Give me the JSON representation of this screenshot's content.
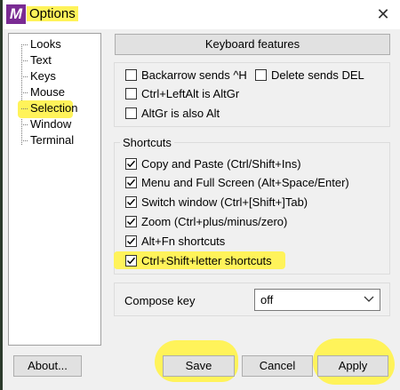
{
  "window": {
    "title": "Options",
    "app_icon": "mintty-logo"
  },
  "tree": {
    "items": [
      "Looks",
      "Text",
      "Keys",
      "Mouse",
      "Selection",
      "Window",
      "Terminal"
    ],
    "selected": "Keys"
  },
  "header": {
    "label": "Keyboard features"
  },
  "features": [
    {
      "label": "Backarrow sends ^H",
      "checked": false
    },
    {
      "label": "Delete sends DEL",
      "checked": false
    },
    {
      "label": "Ctrl+LeftAlt is AltGr",
      "checked": false
    },
    {
      "label": "AltGr is also Alt",
      "checked": false
    }
  ],
  "shortcuts": {
    "title": "Shortcuts",
    "items": [
      {
        "label": "Copy and Paste (Ctrl/Shift+Ins)",
        "checked": true
      },
      {
        "label": "Menu and Full Screen (Alt+Space/Enter)",
        "checked": true
      },
      {
        "label": "Switch window (Ctrl+[Shift+]Tab)",
        "checked": true
      },
      {
        "label": "Zoom (Ctrl+plus/minus/zero)",
        "checked": true
      },
      {
        "label": "Alt+Fn shortcuts",
        "checked": true
      },
      {
        "label": "Ctrl+Shift+letter shortcuts",
        "checked": true
      }
    ]
  },
  "compose": {
    "label": "Compose key",
    "value": "off"
  },
  "buttons": {
    "about": "About...",
    "save": "Save",
    "cancel": "Cancel",
    "apply": "Apply"
  },
  "colors": {
    "highlight": "#fff35a",
    "accent": "#7a2b93"
  }
}
